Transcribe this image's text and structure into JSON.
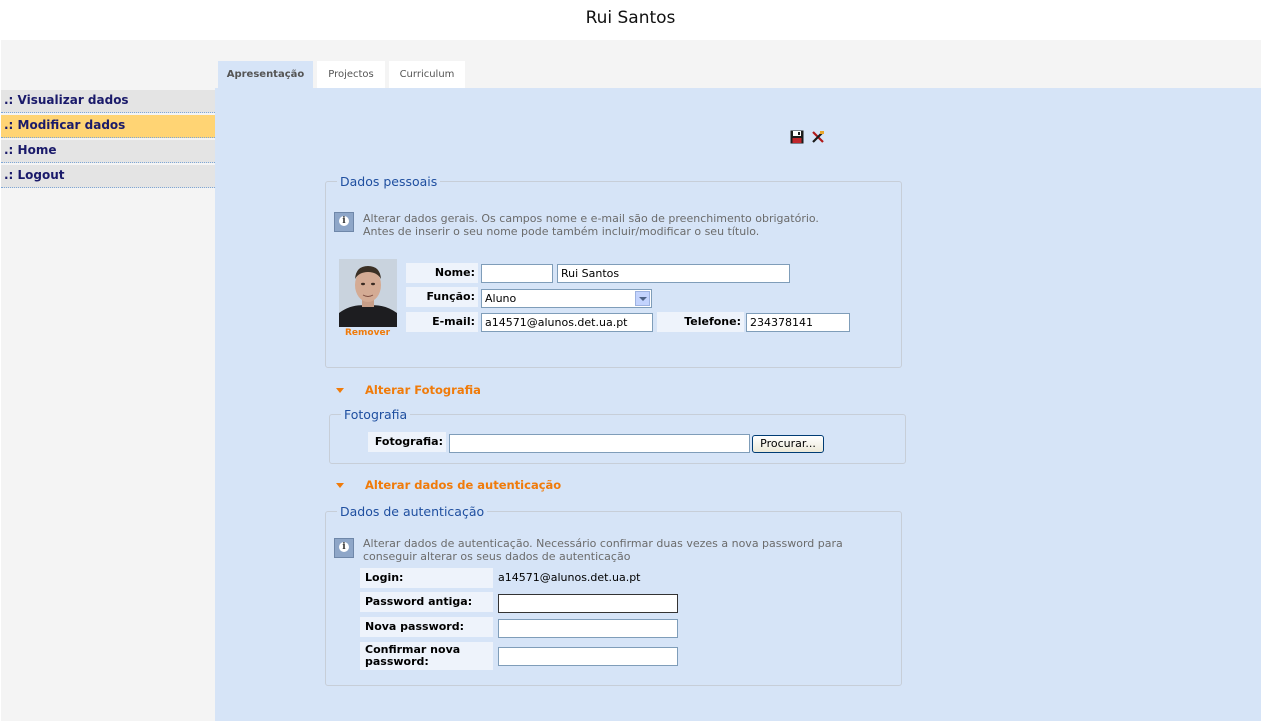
{
  "page": {
    "title": "Rui Santos"
  },
  "sidebar": {
    "items": [
      {
        "label": ".: Visualizar dados"
      },
      {
        "label": ".: Modificar dados"
      },
      {
        "label": ".: Home"
      },
      {
        "label": ".: Logout"
      }
    ],
    "active_index": 1
  },
  "tabs": [
    {
      "label": "Apresentação",
      "active": true
    },
    {
      "label": "Projectos",
      "active": false
    },
    {
      "label": "Curriculum",
      "active": false
    }
  ],
  "toolbar": {
    "icons": [
      "save-icon",
      "cancel-icon"
    ]
  },
  "personal": {
    "legend": "Dados pessoais",
    "info": "Alterar dados gerais. Os campos nome e e-mail são de preenchimento obrigatório. Antes de inserir o seu nome pode também incluir/modificar o seu título.",
    "photo_remove": "Remover",
    "name_label": "Nome:",
    "title_value": "",
    "name_value": "Rui Santos",
    "function_label": "Função:",
    "function_value": "Aluno",
    "email_label": "E-mail:",
    "email_value": "a14571@alunos.det.ua.pt",
    "phone_label": "Telefone:",
    "phone_value": "234378141"
  },
  "photo_section": {
    "header": "Alterar Fotografia",
    "legend": "Fotografia",
    "label": "Fotografia:",
    "value": "",
    "browse_button": "Procurar..."
  },
  "auth_section": {
    "header": "Alterar dados de autenticação",
    "legend": "Dados de autenticação",
    "info": "Alterar dados de autenticação. Necessário confirmar duas vezes a nova password para conseguir alterar os seus dados de autenticação",
    "login_label": "Login:",
    "login_value": "a14571@alunos.det.ua.pt",
    "old_password_label": "Password antiga:",
    "new_password_label": "Nova password:",
    "confirm_password_label": "Confirmar nova password:"
  },
  "colors": {
    "accent_orange": "#f07b0a",
    "panel_blue": "#d6e4f7",
    "legend_blue": "#1f4fa0",
    "active_menu": "#ffd474"
  }
}
